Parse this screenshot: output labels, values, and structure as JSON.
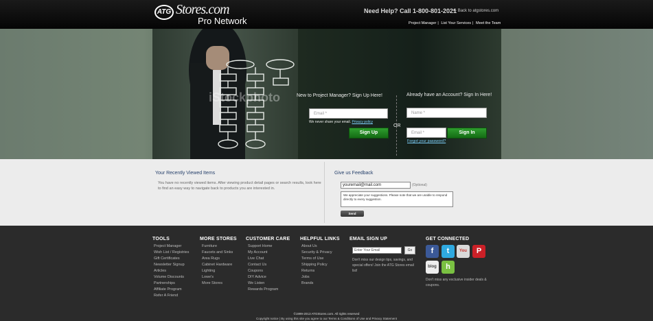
{
  "header": {
    "logo_mark": "ATG",
    "logo_stores": "Stores.com",
    "logo_sub": "Pro Network",
    "help_text": "Need Help? Call 1-800-801-2021",
    "back_link": "Back to atgstores.com",
    "links": [
      "Project Manager",
      "List Your Services",
      "Meet the Team"
    ]
  },
  "hero": {
    "watermark": "iStockphoto",
    "signup": {
      "title": "New to Project Manager? Sign Up Here!",
      "email_placeholder": "Email *",
      "note": "We never share your email.",
      "privacy_link": "Privacy policy",
      "button": "Sign Up"
    },
    "or_text": "OR",
    "signin": {
      "title": "Already have an Account? Sign In Here!",
      "name_placeholder": "Name *",
      "email_placeholder": "Email *",
      "button": "Sign In",
      "forgot": "Forgot your password?"
    }
  },
  "recent": {
    "title": "Your Recently Viewed Items",
    "text": "You have no recently viewed items. After viewing product detail pages or search results, look here to find an easy way to navigate back to products you are interested in."
  },
  "feedback": {
    "title": "Give us Feedback",
    "email_value": "youremail@mail.com",
    "optional": "(Optional)",
    "message": "We appreciate your suggestions. Please note that we are unable to respond directly to every suggestion.",
    "send": "Send"
  },
  "footer": {
    "tools": {
      "title": "TOOLS",
      "items": [
        "Project Manager",
        "Wish List / Registries",
        "Gift Certificates",
        "Newsletter Signup",
        "Articles",
        "Volume Discounts",
        "Partnerships",
        "Affiliate Program",
        "Refer A Friend"
      ]
    },
    "more_stores": {
      "title": "MORE STORES",
      "items": [
        "Furniture",
        "Faucets and Sinks",
        "Area Rugs",
        "Cabinet Hardware",
        "Lighting",
        "Lowe's",
        "More Stores"
      ]
    },
    "customer_care": {
      "title": "CUSTOMER CARE",
      "items": [
        "Support Home",
        "My Account",
        "Live Chat",
        "Contact Us",
        "Coupons",
        "DIY Advice",
        "We Listen",
        "Rewards Program"
      ]
    },
    "helpful_links": {
      "title": "HELPFUL LINKS",
      "items": [
        "About Us",
        "Security & Privacy",
        "Terms of Use",
        "Shipping Policy",
        "Returns",
        "Jobs",
        "Brands"
      ]
    },
    "email_signup": {
      "title": "EMAIL SIGN UP",
      "placeholder": "Enter Your Email",
      "go": "Go",
      "note": "Don't miss our design tips, savings, and special offers! Join the ATG Stores email list!"
    },
    "connect": {
      "title": "GET CONNECTED",
      "icons": [
        "facebook-icon",
        "twitter-icon",
        "youtube-icon",
        "pinterest-icon",
        "blog-icon",
        "houzz-icon"
      ],
      "note": "Don't miss any exclusive insider deals & coupons."
    },
    "copyright": "©1999-2013 ATGStores.com. All rights reserved",
    "terms": "Copyright notice | By using this site you agree to our Terms & Conditions of Use and Privacy Statement"
  }
}
